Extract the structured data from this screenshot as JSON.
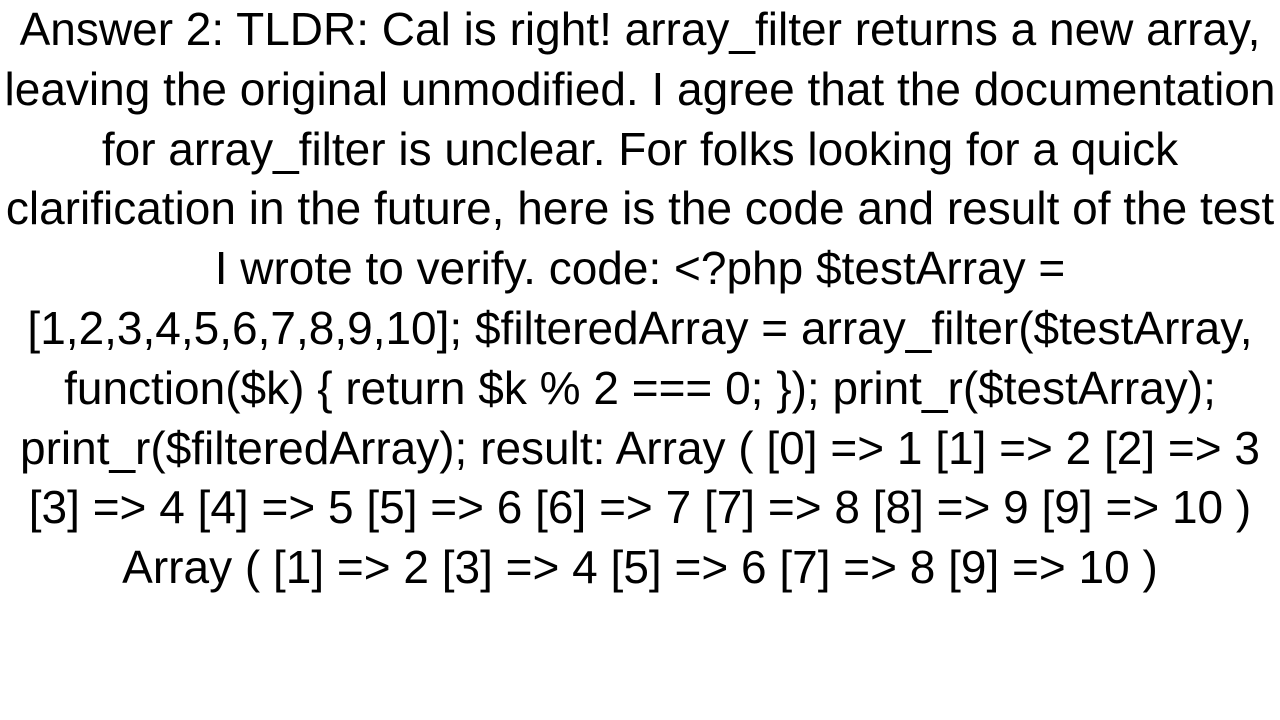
{
  "answer": {
    "label": "Answer 2:",
    "tldr": "TLDR: Cal is right! array_filter returns a new array, leaving the original unmodified. I agree that the documentation for array_filter is unclear. For folks looking for a quick clarification in the future, here is the code and result of the test I wrote to verify.",
    "code_label": "code:",
    "code": "<?php $testArray = [1,2,3,4,5,6,7,8,9,10];  $filteredArray = array_filter($testArray, function($k) {   return $k % 2 === 0; });  print_r($testArray); print_r($filteredArray);",
    "result_label": "result:",
    "result": "Array (     [0] => 1     [1] => 2     [2] => 3     [3] => 4     [4] => 5     [5] => 6     [6] => 7     [7] => 8     [8] => 9     [9] => 10 ) Array (     [1] => 2     [3] => 4     [5] => 6     [7] => 8     [9] => 10 )"
  },
  "full_text": "Answer 2: TLDR: Cal is right! array_filter returns a new array, leaving the original unmodified. I agree that the documentation for array_filter is unclear. For folks looking for a quick clarification in the future, here is the code and result of the test I wrote to verify. code: <?php $testArray = [1,2,3,4,5,6,7,8,9,10];  $filteredArray = array_filter($testArray, function($k) {   return $k % 2 === 0; });  print_r($testArray); print_r($filteredArray); result: Array (     [0] => 1     [1] => 2     [2] => 3     [3] => 4     [4] => 5     [5] => 6     [6] => 7     [7] => 8     [8] => 9     [9] => 10 ) Array (     [1] => 2     [3] => 4     [5] => 6     [7] => 8     [9] => 10 )"
}
